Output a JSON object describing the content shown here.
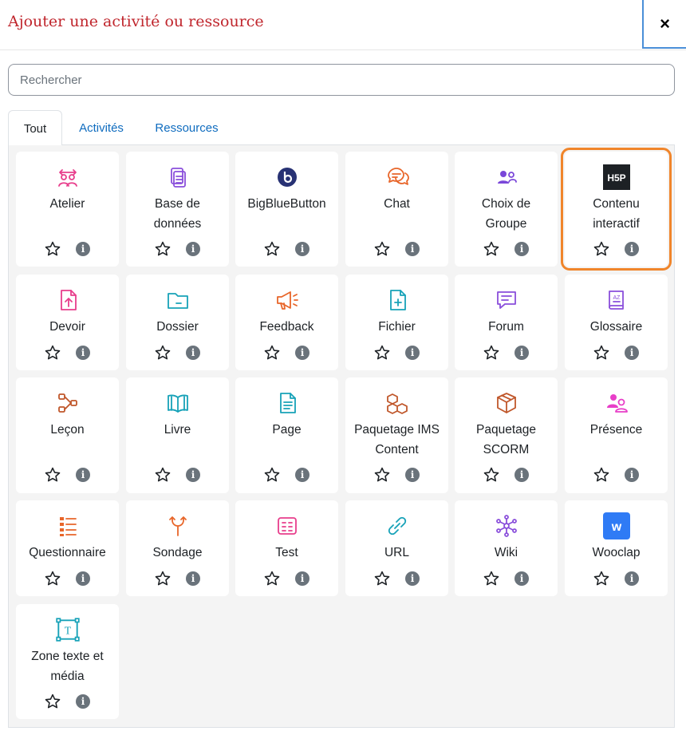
{
  "dialog": {
    "title": "Ajouter une activité ou ressource",
    "close_label": "×"
  },
  "search": {
    "placeholder": "Rechercher",
    "value": ""
  },
  "tabs": [
    {
      "label": "Tout",
      "active": true
    },
    {
      "label": "Activités",
      "active": false
    },
    {
      "label": "Ressources",
      "active": false
    }
  ],
  "info_glyph": "i",
  "items": [
    {
      "name": "Atelier",
      "icon": "workshop-icon",
      "color": "#e83e8c"
    },
    {
      "name": "Base de données",
      "icon": "database-icon",
      "color": "#8a4fdb"
    },
    {
      "name": "BigBlueButton",
      "icon": "bigbluebutton-icon",
      "color": "#283274"
    },
    {
      "name": "Chat",
      "icon": "chat-icon",
      "color": "#e8662a"
    },
    {
      "name": "Choix de Groupe",
      "icon": "group-choice-icon",
      "color": "#7a47d9"
    },
    {
      "name": "Contenu interactif",
      "icon": "h5p-icon",
      "color": "#1d2125",
      "icon_text": "H5P",
      "highlighted": true
    },
    {
      "name": "Devoir",
      "icon": "assignment-icon",
      "color": "#e83e8c"
    },
    {
      "name": "Dossier",
      "icon": "folder-icon",
      "color": "#17a2b8"
    },
    {
      "name": "Feedback",
      "icon": "feedback-icon",
      "color": "#e8662a"
    },
    {
      "name": "Fichier",
      "icon": "file-icon",
      "color": "#17a2b8"
    },
    {
      "name": "Forum",
      "icon": "forum-icon",
      "color": "#8a4fdb"
    },
    {
      "name": "Glossaire",
      "icon": "glossary-icon",
      "color": "#8a4fdb",
      "icon_text": "AZ"
    },
    {
      "name": "Leçon",
      "icon": "lesson-icon",
      "color": "#c0572b"
    },
    {
      "name": "Livre",
      "icon": "book-icon",
      "color": "#17a2b8"
    },
    {
      "name": "Page",
      "icon": "page-icon",
      "color": "#17a2b8"
    },
    {
      "name": "Paquetage IMS Content",
      "icon": "ims-package-icon",
      "color": "#c0572b"
    },
    {
      "name": "Paquetage SCORM",
      "icon": "scorm-package-icon",
      "color": "#c0572b"
    },
    {
      "name": "Présence",
      "icon": "attendance-icon",
      "color": "#e83ec8"
    },
    {
      "name": "Questionnaire",
      "icon": "questionnaire-icon",
      "color": "#e8662a"
    },
    {
      "name": "Sondage",
      "icon": "survey-icon",
      "color": "#e8662a"
    },
    {
      "name": "Test",
      "icon": "quiz-icon",
      "color": "#e83e8c"
    },
    {
      "name": "URL",
      "icon": "url-icon",
      "color": "#17a2b8"
    },
    {
      "name": "Wiki",
      "icon": "wiki-icon",
      "color": "#8a4fdb"
    },
    {
      "name": "Wooclap",
      "icon": "wooclap-icon",
      "color": "#2f7bf5",
      "icon_text": "w"
    },
    {
      "name": "Zone texte et média",
      "icon": "text-media-icon",
      "color": "#17a2b8",
      "icon_text": "T"
    }
  ]
}
